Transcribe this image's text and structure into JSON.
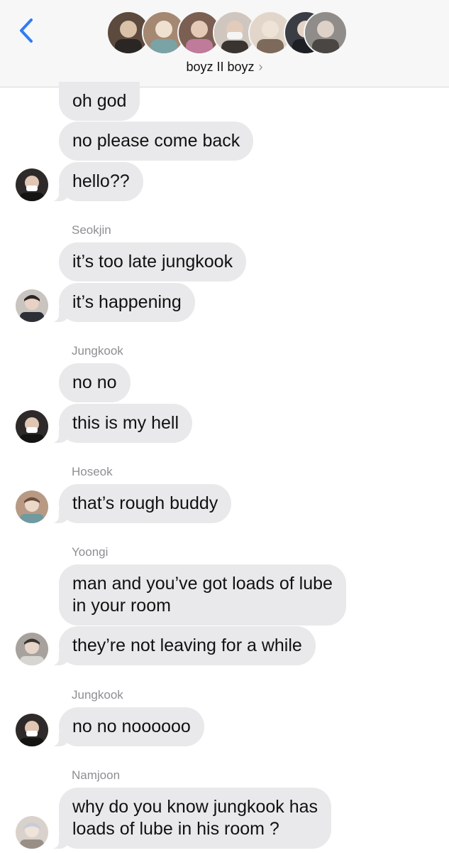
{
  "header": {
    "title": "boyz II boyz",
    "chevron": "›",
    "back_icon": "chevron-left-icon",
    "accent": "#2f7cf6",
    "group_avatars": [
      {
        "bg": "#5b4a3d",
        "fg": "#d9c2a8"
      },
      {
        "bg": "#a48872",
        "fg": "#efe0cf"
      },
      {
        "bg": "#7a5f52",
        "fg": "#e5c9b7"
      },
      {
        "bg": "#cfc6bf",
        "fg": "#3a3431"
      },
      {
        "bg": "#e2d6cb",
        "fg": "#7d6a5b"
      },
      {
        "bg": "#3a3d44",
        "fg": "#e4d3c6"
      },
      {
        "bg": "#8f8c89",
        "fg": "#ddd1c8"
      }
    ]
  },
  "colors": {
    "bubble": "#e9e9eb",
    "sender_name": "#8e8e93",
    "text": "#111111"
  },
  "messages": [
    {
      "text": "oh god"
    },
    {
      "text": "no please come back"
    },
    {
      "text": "hello??"
    },
    {
      "sender": "Seokjin"
    },
    {
      "text": "it’s too late jungkook"
    },
    {
      "text": "it’s happening"
    },
    {
      "sender": "Jungkook"
    },
    {
      "text": "no no"
    },
    {
      "text": "this is my hell"
    },
    {
      "sender": "Hoseok"
    },
    {
      "text": "that’s rough buddy"
    },
    {
      "sender": "Yoongi"
    },
    {
      "text": "man and you’ve got loads of lube\nin your room"
    },
    {
      "text": "they’re not leaving for a while"
    },
    {
      "sender": "Jungkook"
    },
    {
      "text": "no no noooooo"
    },
    {
      "sender": "Namjoon"
    },
    {
      "text": "why do you know jungkook has\nloads of lube in his room ?"
    }
  ]
}
